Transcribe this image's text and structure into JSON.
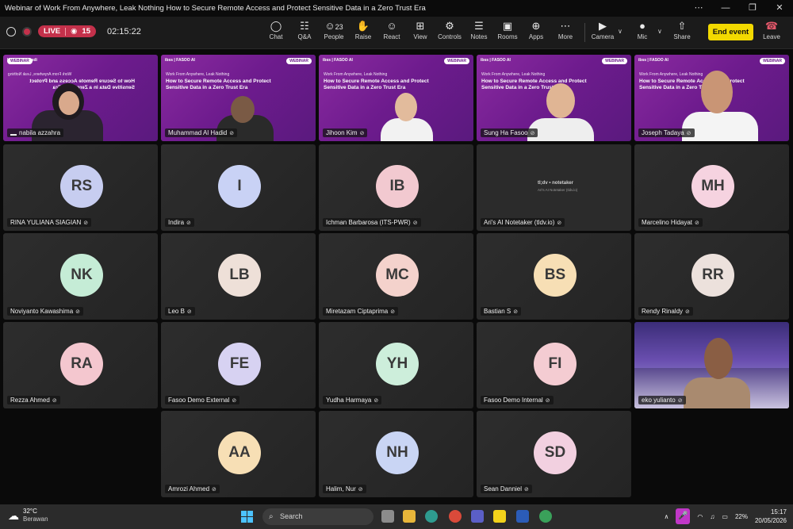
{
  "window": {
    "title": "Webinar of Work From Anywhere, Leak Nothing How to Secure Remote Access and Protect Sensitive Data in a Zero Trust Era",
    "controls": [
      "⋯",
      "—",
      "❐",
      "✕"
    ]
  },
  "toolbar": {
    "live_label": "LIVE",
    "viewers": "15",
    "timer": "02:15:22",
    "buttons": [
      {
        "label": "Chat",
        "icon": "◯"
      },
      {
        "label": "Q&A",
        "icon": "☷"
      },
      {
        "label": "People",
        "icon": "☺",
        "count": "23"
      },
      {
        "label": "Raise",
        "icon": "✋"
      },
      {
        "label": "React",
        "icon": "☺"
      },
      {
        "label": "View",
        "icon": "⊞"
      },
      {
        "label": "Controls",
        "icon": "⚙"
      },
      {
        "label": "Notes",
        "icon": "☰"
      },
      {
        "label": "Rooms",
        "icon": "▣"
      },
      {
        "label": "Apps",
        "icon": "⊕"
      },
      {
        "label": "More",
        "icon": "⋯"
      },
      {
        "label": "Camera",
        "icon": "▶"
      },
      {
        "label": "Mic",
        "icon": "●"
      },
      {
        "label": "Share",
        "icon": "⇧"
      }
    ],
    "end_event": "End event",
    "leave": "Leave"
  },
  "slide": {
    "logo_left": "ibss | FASOO AI",
    "badge": "WEBINAR",
    "subtitle": "Work From Anywhere, Leak Nothing",
    "heading": "How to Secure Remote Access and Protect Sensitive Data in a Zero Trust Era"
  },
  "video_tiles": [
    {
      "name": "nabila azzahra"
    },
    {
      "name": "Muhammad Al Hadid"
    },
    {
      "name": "Jihoon Kim"
    },
    {
      "name": "Sung Ha Fasoo"
    },
    {
      "name": "Joseph Tadaya"
    }
  ],
  "tiles": [
    {
      "initials": "RS",
      "name": "RINA YULIANA SIAGIAN",
      "color": "#c7cdf0"
    },
    {
      "initials": "I",
      "name": "Indira",
      "color": "#c9d2f5"
    },
    {
      "initials": "IB",
      "name": "Ichman Barbarosa (ITS-PWR)",
      "color": "#f2c9d0"
    },
    {
      "initials": "",
      "name": "Ari's AI Notetaker (tldv.io)",
      "color": ""
    },
    {
      "initials": "MH",
      "name": "Marcelino Hidayat",
      "color": "#f6d3e0"
    },
    {
      "initials": "NK",
      "name": "Noviyanto Kawashima",
      "color": "#c5ecd6"
    },
    {
      "initials": "LB",
      "name": "Leo B",
      "color": "#eee0d8"
    },
    {
      "initials": "MC",
      "name": "Miretazam Ciptaprima",
      "color": "#f4d2cc"
    },
    {
      "initials": "BS",
      "name": "Bastian S",
      "color": "#f7dfb5"
    },
    {
      "initials": "RR",
      "name": "Rendy Rinaldy",
      "color": "#ece1dc"
    },
    {
      "initials": "RA",
      "name": "Rezza Ahmed",
      "color": "#f4c7cf"
    },
    {
      "initials": "FE",
      "name": "Fasoo Demo External",
      "color": "#d7d2f2"
    },
    {
      "initials": "YH",
      "name": "Yudha Harmaya",
      "color": "#cdeedb"
    },
    {
      "initials": "FI",
      "name": "Fasoo Demo Internal",
      "color": "#f4ccd2"
    },
    {
      "initials": "",
      "name": "eko yulianto",
      "color": ""
    },
    {
      "initials": "AA",
      "name": "Amrozi Ahmed",
      "color": "#f7dfb5"
    },
    {
      "initials": "NH",
      "name": "Halim, Nur",
      "color": "#c9d5f4"
    },
    {
      "initials": "SD",
      "name": "Sean Danniel",
      "color": "#f2d0e0"
    }
  ],
  "notetaker": {
    "logo": "tl;dv • notetaker",
    "sub": "Ari's AI Notetaker (tldv.io)"
  },
  "taskbar": {
    "temp": "32°C",
    "weather": "Berawan",
    "search": "Search",
    "time": "15:17",
    "date": "20/05/2026",
    "battery": "22%"
  }
}
